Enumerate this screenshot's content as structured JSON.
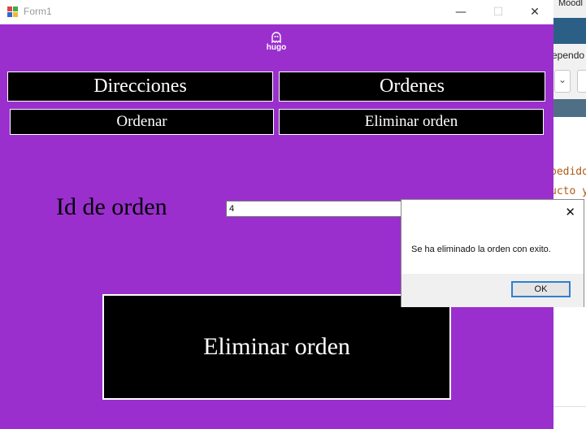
{
  "background_app": {
    "title_fragment": "Moodl",
    "sub_text": "ependo",
    "code_lines": [
      "pedido",
      "ucto y"
    ]
  },
  "window": {
    "title": "Form1",
    "logo_text": "hugo",
    "controls": {
      "minimize": "—",
      "maximize": "☐",
      "close": "✕"
    }
  },
  "nav": {
    "direcciones": "Direcciones",
    "ordenes": "Ordenes",
    "ordenar": "Ordenar",
    "eliminar_orden": "Eliminar orden"
  },
  "form": {
    "id_label": "Id de orden",
    "id_value": "4",
    "submit_label": "Eliminar orden"
  },
  "dialog": {
    "message": "Se ha eliminado la orden con exito.",
    "ok_label": "OK",
    "close_symbol": "✕"
  },
  "colors": {
    "form_bg": "#9a2fce",
    "button_bg": "#000000",
    "button_text": "#ffffff"
  }
}
